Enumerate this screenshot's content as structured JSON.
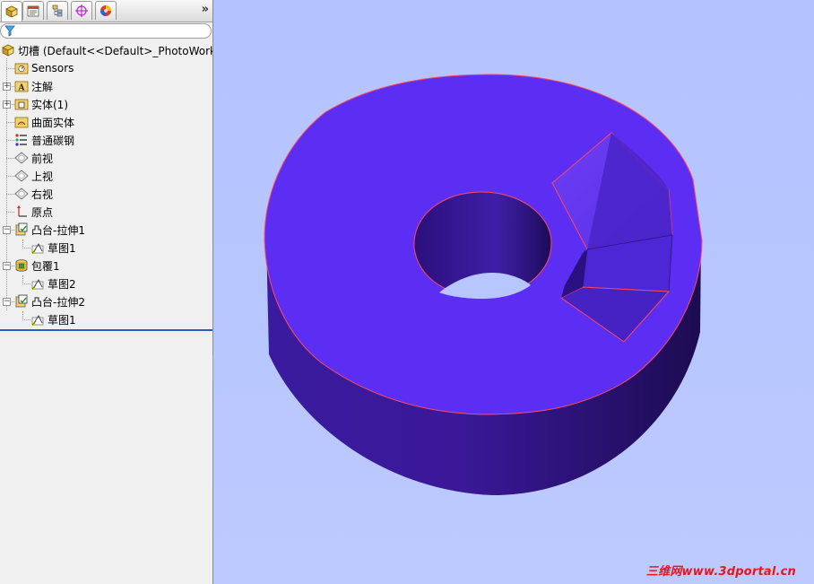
{
  "tabs": [
    {
      "name": "feature-manager",
      "icon": "feature-tree-icon",
      "active": true
    },
    {
      "name": "property-manager",
      "icon": "property-sheet-icon",
      "active": false
    },
    {
      "name": "configuration-manager",
      "icon": "configuration-icon",
      "active": false
    },
    {
      "name": "dim-xpert",
      "icon": "crosshair-target-icon",
      "active": false
    },
    {
      "name": "display-manager",
      "icon": "appearance-sphere-icon",
      "active": false
    }
  ],
  "tabs_more_label": "»",
  "filter": {
    "value": "",
    "placeholder": ""
  },
  "tree": {
    "root": {
      "label": "切槽  (Default<<Default>_PhotoWorks",
      "icon": "part-icon"
    },
    "items": [
      {
        "label": "Sensors",
        "icon": "sensors-folder-icon",
        "indent": 1,
        "expander": ""
      },
      {
        "label": "注解",
        "icon": "annotations-folder-icon",
        "indent": 1,
        "expander": "+"
      },
      {
        "label": "实体(1)",
        "icon": "solid-bodies-folder-icon",
        "indent": 1,
        "expander": "+"
      },
      {
        "label": "曲面实体",
        "icon": "surface-bodies-folder-icon",
        "indent": 1,
        "expander": ""
      },
      {
        "label": "普通碳钢",
        "icon": "material-icon",
        "indent": 1,
        "expander": ""
      },
      {
        "label": "前视",
        "icon": "plane-icon",
        "indent": 1,
        "expander": ""
      },
      {
        "label": "上视",
        "icon": "plane-icon",
        "indent": 1,
        "expander": ""
      },
      {
        "label": "右视",
        "icon": "plane-icon",
        "indent": 1,
        "expander": ""
      },
      {
        "label": "原点",
        "icon": "origin-icon",
        "indent": 1,
        "expander": ""
      },
      {
        "label": "凸台-拉伸1",
        "icon": "boss-extrude-icon",
        "indent": 1,
        "expander": "−"
      },
      {
        "label": "草图1",
        "icon": "sketch-icon",
        "indent": 2,
        "expander": ""
      },
      {
        "label": "包覆1",
        "icon": "wrap-feature-icon",
        "indent": 1,
        "expander": "−"
      },
      {
        "label": "草图2",
        "icon": "sketch-icon",
        "indent": 2,
        "expander": ""
      },
      {
        "label": "凸台-拉伸2",
        "icon": "boss-extrude-icon",
        "indent": 1,
        "expander": "−"
      },
      {
        "label": "草图1",
        "icon": "sketch-icon",
        "indent": 2,
        "expander": ""
      }
    ]
  },
  "viewport": {
    "background": "#b8c6ff",
    "model_color": "#5b2ef0",
    "edge_color": "#ff4a5a"
  },
  "watermark": "三维网www.3dportal.cn"
}
